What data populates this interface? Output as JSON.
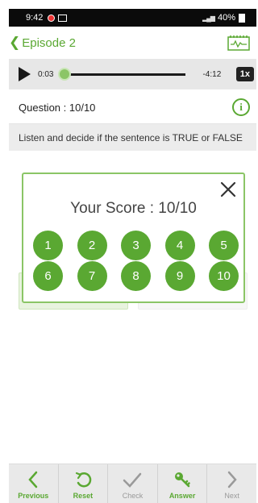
{
  "status_bar": {
    "time": "9:42",
    "battery": "40%"
  },
  "header": {
    "back_label": "Episode 2"
  },
  "player": {
    "current_time": "0:03",
    "remaining_time": "-4:12",
    "speed": "1x",
    "progress": 0.02
  },
  "question": {
    "label": "Question : 10/10"
  },
  "instruction": "Listen and decide if the sentence is TRUE or FALSE",
  "modal": {
    "score": "Your Score : 10/10",
    "numbers": [
      "1",
      "2",
      "3",
      "4",
      "5",
      "6",
      "7",
      "8",
      "9",
      "10"
    ]
  },
  "nav": {
    "items": [
      {
        "label": "Previous",
        "state": "active"
      },
      {
        "label": "Reset",
        "state": "active"
      },
      {
        "label": "Check",
        "state": "inactive"
      },
      {
        "label": "Answer",
        "state": "active"
      },
      {
        "label": "Next",
        "state": "inactive"
      }
    ]
  },
  "colors": {
    "accent": "#5aa832",
    "accent_light": "#8bc566",
    "dark": "#1a1a1a"
  }
}
